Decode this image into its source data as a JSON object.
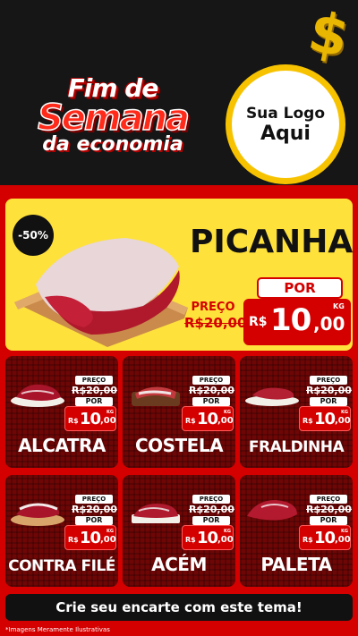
{
  "header": {
    "title_line1": "Fim de",
    "title_line2": "Semana",
    "title_line3": "da economia",
    "logo_line1": "Sua Logo",
    "logo_line2": "Aqui",
    "coin_icon": "dollar-coin-icon"
  },
  "featured": {
    "discount": "-50%",
    "name": "PICANHA",
    "por_label": "POR",
    "preco_label": "PREÇO",
    "old_price": "R$20,00",
    "currency": "R$",
    "price_int": "10",
    "price_dec": ",00",
    "unit": "KG"
  },
  "product_labels": {
    "preco": "PREÇO",
    "por": "POR",
    "old_price": "R$20,00",
    "currency": "R$",
    "unit": "KG"
  },
  "products": [
    {
      "name": "ALCATRA",
      "price_int": "10",
      "price_dec": ",00"
    },
    {
      "name": "COSTELA",
      "price_int": "10",
      "price_dec": ",00"
    },
    {
      "name": "FRALDINHA",
      "price_int": "10",
      "price_dec": ",00"
    },
    {
      "name": "CONTRA FILÉ",
      "price_int": "10",
      "price_dec": ",00"
    },
    {
      "name": "ACÉM",
      "price_int": "10",
      "price_dec": ",00"
    },
    {
      "name": "PALETA",
      "price_int": "10",
      "price_dec": ",00"
    }
  ],
  "footer": {
    "cta": "Crie seu encarte com este tema!",
    "disclaimer": "*Imagens Meramente Ilustrativas"
  },
  "colors": {
    "brand_red": "#d40000",
    "accent_yellow": "#ffe13b",
    "dark": "#141414"
  }
}
